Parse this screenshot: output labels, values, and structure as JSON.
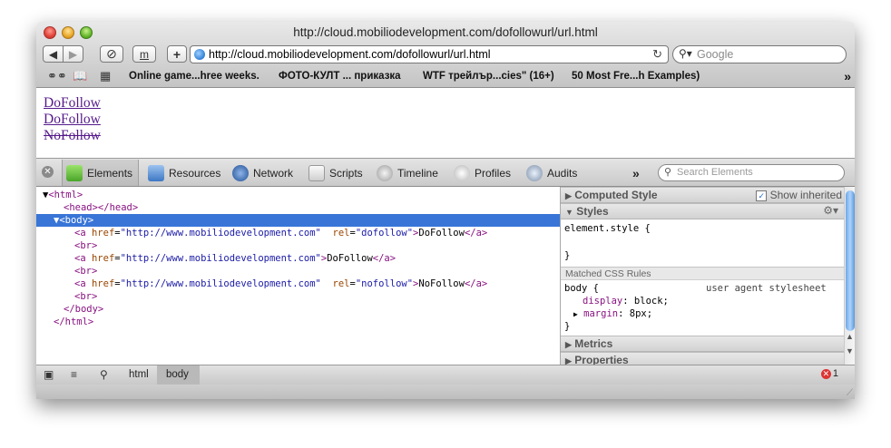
{
  "window": {
    "title": "http://cloud.mobiliodevelopment.com/dofollowurl/url.html"
  },
  "toolbar": {
    "back_label": "◀",
    "forward_label": "▶",
    "stop_label": "⊘",
    "reader_label": "m",
    "add_label": "+",
    "url": "http://cloud.mobiliodevelopment.com/dofollowurl/url.html",
    "reload_label": "↻",
    "search_placeholder": "Google",
    "search_icon": "magnifier-icon"
  },
  "bookmarks": {
    "reading_list_icon": "glasses-icon",
    "bookmarks_icon": "book-icon",
    "topsites_icon": "grid-icon",
    "items": [
      "Online game...hree weeks.",
      "ФОТО-КУЛТ ... приказка",
      "WTF трейлър...cies\" (16+)",
      "50 Most Fre...h Examples)"
    ],
    "more_label": "»"
  },
  "page": {
    "links": [
      "DoFollow",
      "DoFollow",
      "NoFollow"
    ]
  },
  "devtools": {
    "tabs": [
      "Elements",
      "Resources",
      "Network",
      "Scripts",
      "Timeline",
      "Profiles",
      "Audits"
    ],
    "selected_tab": "Elements",
    "overflow_label": "»",
    "search_placeholder": "Search Elements",
    "dom": {
      "html_open": "<html>",
      "head": "<head></head>",
      "body_open": "<body>",
      "a_open": "<a",
      "attr_href": "href",
      "attr_rel": "rel",
      "href_value": "\"http://www.mobiliodevelopment.com\"",
      "rel_dofollow": "\"dofollow\"",
      "rel_nofollow": "\"nofollow\"",
      "link_texts": [
        "DoFollow",
        "DoFollow",
        "NoFollow"
      ],
      "a_close": "</a>",
      "br": "<br>",
      "body_close": "</body>",
      "html_close": "</html>"
    },
    "styles": {
      "computed_label": "Computed Style",
      "show_inherited_label": "Show inherited",
      "styles_label": "Styles",
      "element_style": "element.style {",
      "close_brace": "}",
      "matched_label": "Matched CSS Rules",
      "body_selector": "body {",
      "ua_label": "user agent stylesheet",
      "prop1_name": "display",
      "prop1_value": "block;",
      "prop2_name": "margin",
      "prop2_value": "8px;",
      "metrics_label": "Metrics",
      "properties_label": "Properties"
    },
    "status": {
      "breadcrumbs": [
        "html",
        "body"
      ],
      "error_count": "1"
    }
  }
}
